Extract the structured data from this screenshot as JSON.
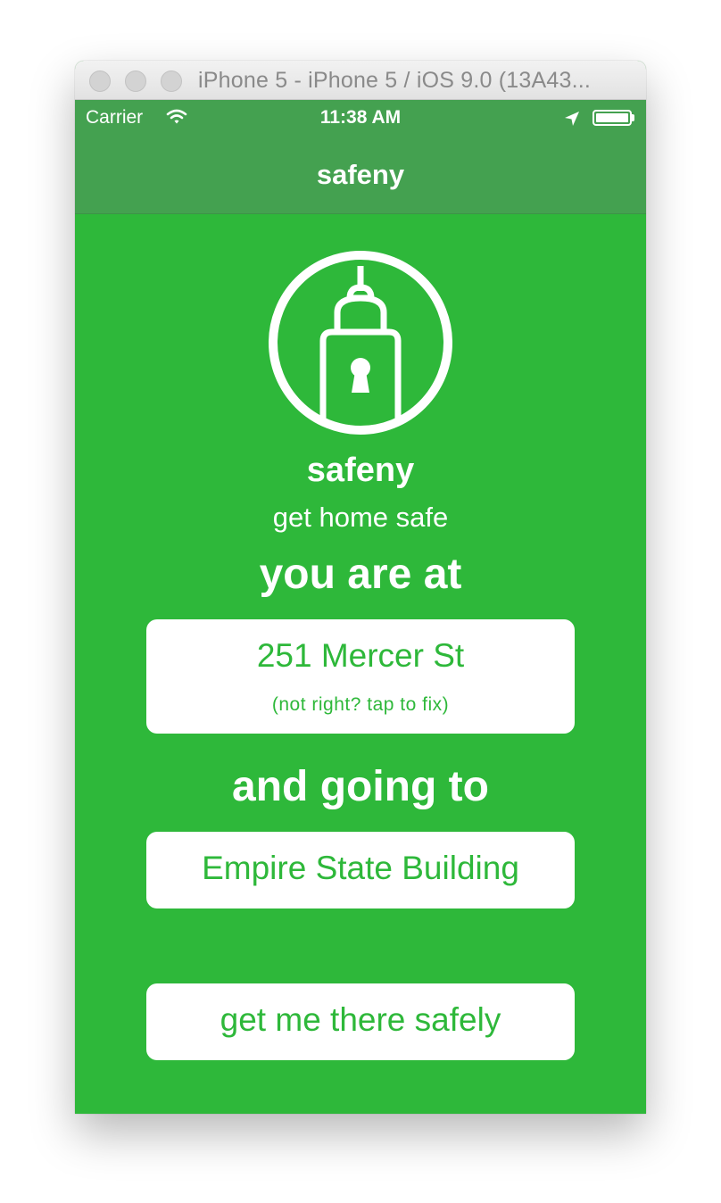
{
  "window": {
    "title": "iPhone 5 - iPhone 5 / iOS 9.0 (13A43..."
  },
  "status_bar": {
    "carrier": "Carrier",
    "time": "11:38 AM",
    "icons": [
      "wifi-icon",
      "location-arrow-icon",
      "battery-icon"
    ]
  },
  "nav": {
    "title": "safeny"
  },
  "hero": {
    "logo_icon": "building-keyhole-logo",
    "app_name": "safeny",
    "tagline": "get home safe"
  },
  "origin": {
    "heading": "you are at",
    "address": "251 Mercer St",
    "hint": "(not right? tap to fix)"
  },
  "destination": {
    "heading": "and going to",
    "place": "Empire State Building"
  },
  "action": {
    "label": "get me there safely"
  },
  "colors": {
    "background": "#2eb83a",
    "bars": "#44a150",
    "card": "#ffffff",
    "accent_text": "#2eb83a"
  }
}
